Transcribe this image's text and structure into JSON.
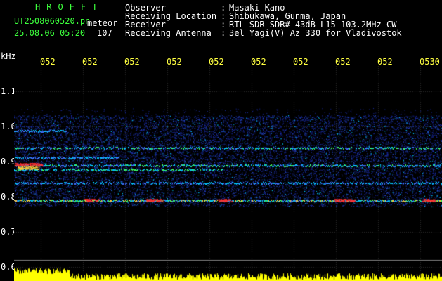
{
  "header": {
    "logo": "HROFFT",
    "file_name": "UT2508060520.pn",
    "meteor_label": "meteor",
    "date_time": "25.08.06 05:20",
    "count": "107"
  },
  "info": {
    "observer_label": "Observer",
    "observer_value": "Masaki Kano",
    "location_label": "Receiving Location",
    "location_value": "Shibukawa, Gunma, Japan",
    "receiver_label": "Receiver",
    "receiver_value": "RTL-SDR SDR# 43dB L15 103.2MHz CW",
    "antenna_label": "Receiving Antenna",
    "antenna_value": "3el Yagi(V) Az 330 for Vladivostok",
    "colon": ":"
  },
  "axis": {
    "y_unit": "kHz",
    "y_ticks": [
      "1.1",
      "1.0",
      "0.9",
      "0.8",
      "0.7",
      "0.6"
    ],
    "x_ticks": [
      "052",
      "052",
      "052",
      "052",
      "052",
      "052",
      "052",
      "052",
      "052",
      "0530"
    ]
  },
  "colors": {
    "background": "#000000",
    "header_text": "#3cff3c",
    "info_text": "#ffffff",
    "time_ticks": "#ffff40",
    "noise": "#1a2aa0",
    "signal_cyan": "#00c8ff",
    "signal_green": "#40ff60",
    "signal_red": "#ff3030",
    "baseline_bars": "#ffff00"
  }
}
